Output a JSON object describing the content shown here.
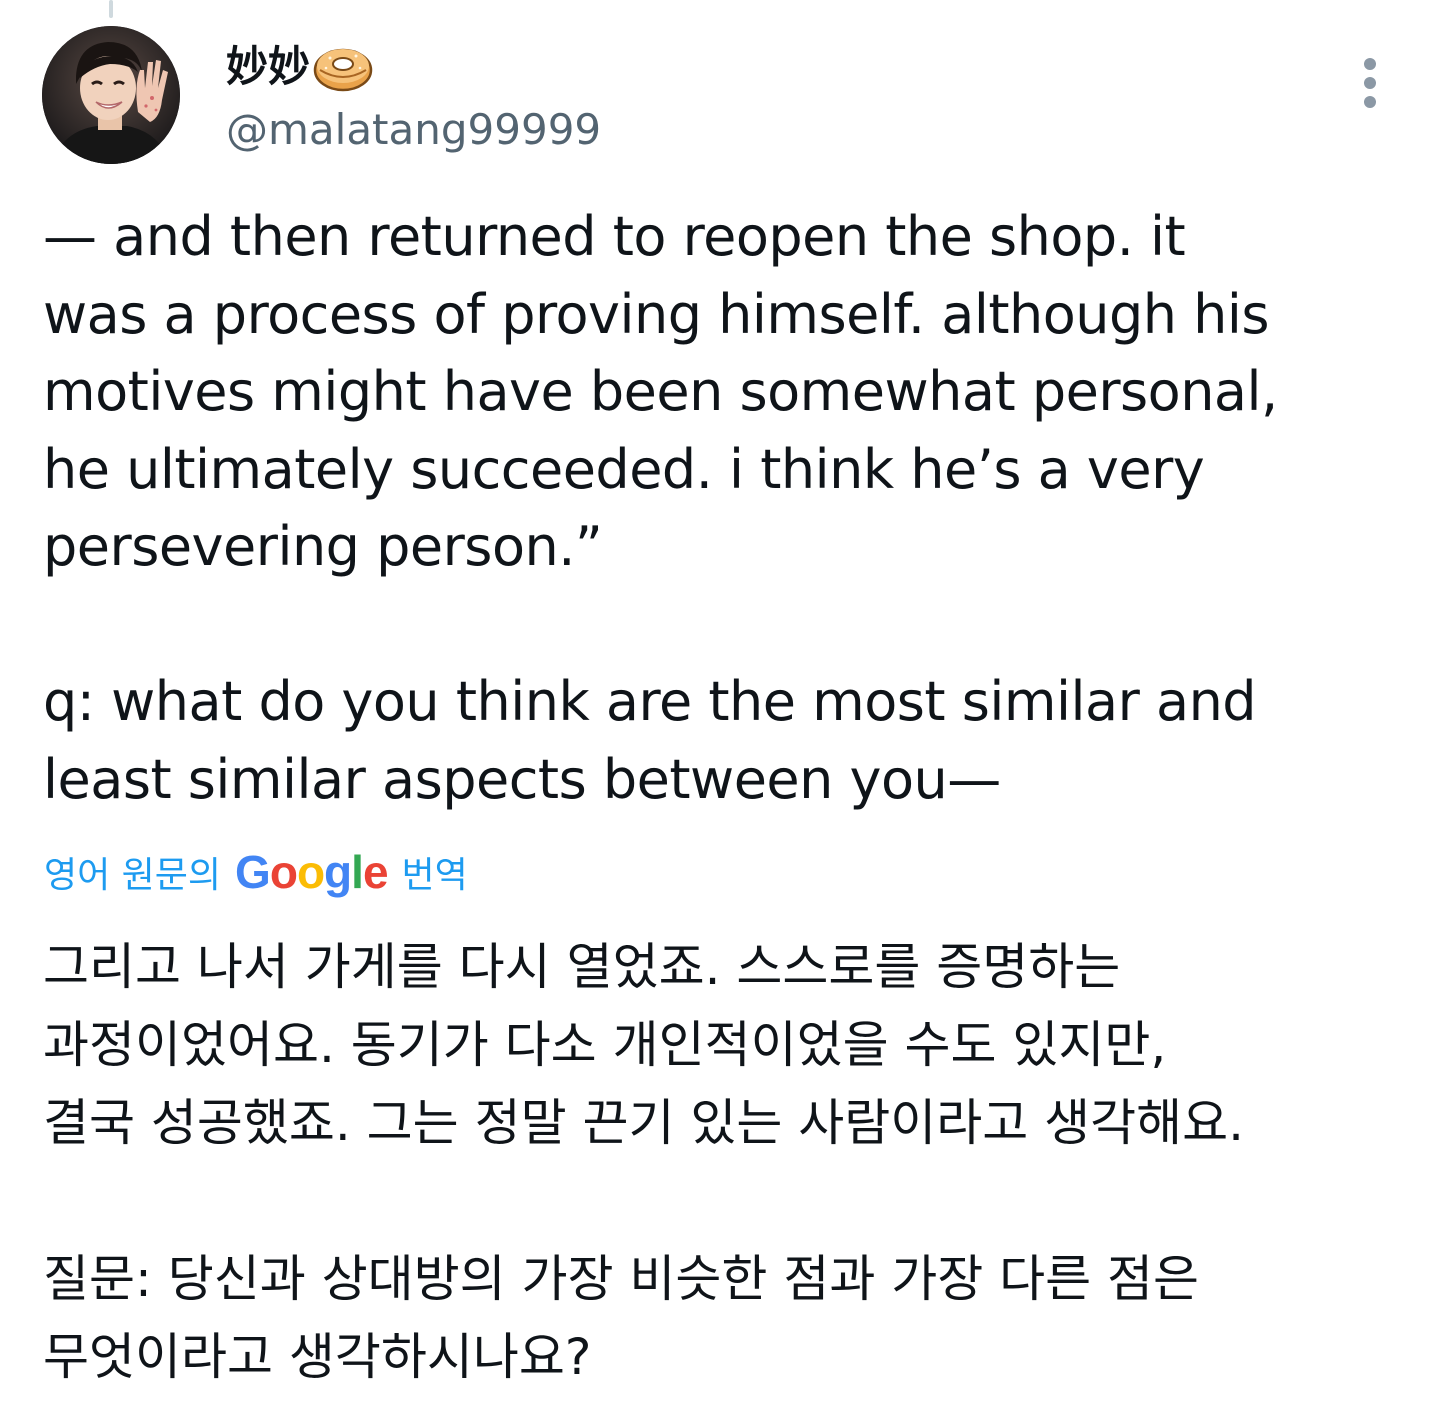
{
  "tweet": {
    "author": {
      "display_name": "妙妙",
      "name_emoji": "bagel-icon",
      "handle": "@malatang99999",
      "avatar": "avatar"
    },
    "more_icon": "more-vertical-icon",
    "text_paragraphs": [
      "— and then returned to reopen the shop. it\nwas a process of proving himself. although his\nmotives might have been somewhat personal,\nhe ultimately succeeded. i think he’s a very\npersevering person.”",
      "q: what do you think are the most similar and\nleast similar aspects between you—"
    ],
    "translation": {
      "prefix": "영어 원문의",
      "provider_letters": [
        "G",
        "o",
        "o",
        "g",
        "l",
        "e"
      ],
      "provider_colors": [
        "#4285F4",
        "#EA4335",
        "#FBBC05",
        "#4285F4",
        "#34A853",
        "#EA4335"
      ],
      "suffix": "번역",
      "paragraphs": [
        "그리고 나서 가게를 다시 열었죠. 스스로를 증명하는\n과정이었어요. 동기가 다소 개인적이었을 수도 있지만,\n결국 성공했죠. 그는 정말 끈기 있는 사람이라고 생각해요.",
        "질문: 당신과 상대방의 가장 비슷한 점과 가장 다른 점은\n무엇이라고 생각하시나요?"
      ]
    },
    "colors": {
      "text": "#0f1419",
      "secondary": "#536471",
      "link": "#1d9bf0",
      "thread_line": "#cfd9de"
    }
  }
}
